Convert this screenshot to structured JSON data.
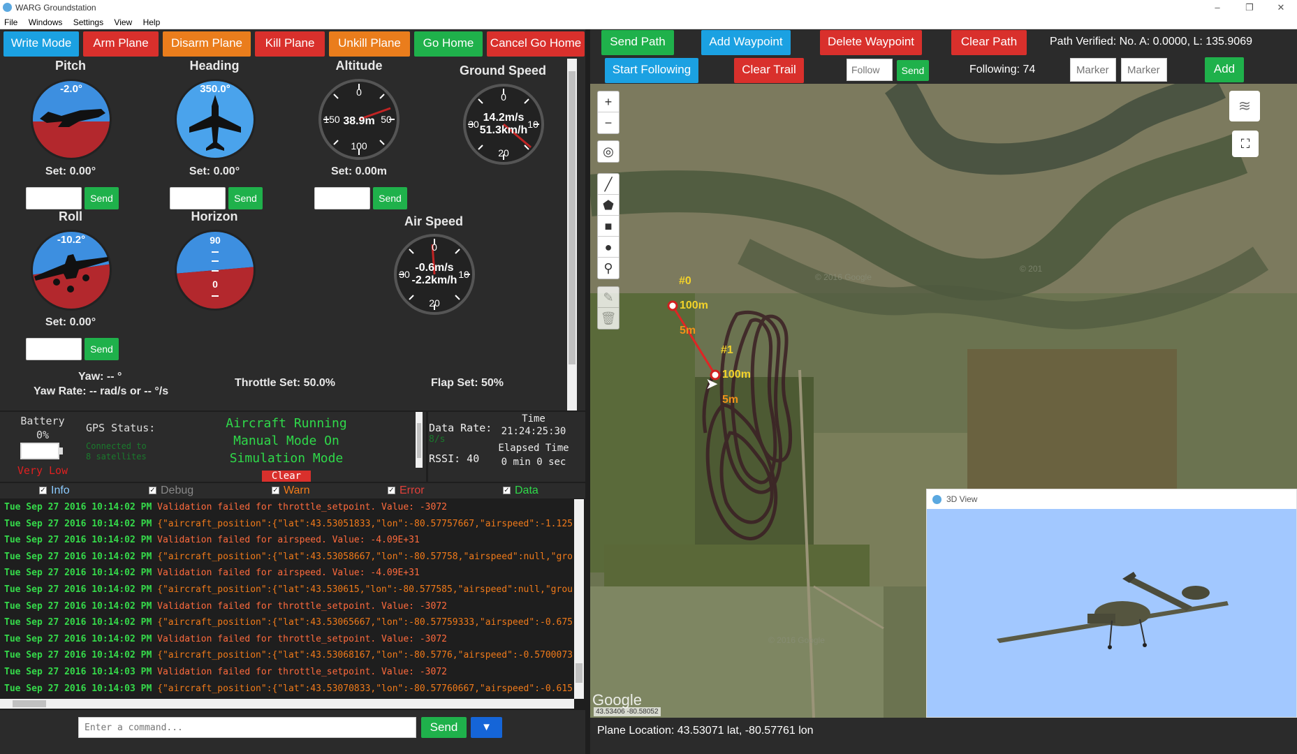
{
  "window": {
    "title": "WARG Groundstation",
    "minimize": "–",
    "restore": "❐",
    "close": "✕"
  },
  "menu": [
    "File",
    "Windows",
    "Settings",
    "View",
    "Help"
  ],
  "toolbar_left": [
    "Write Mode",
    "Arm Plane",
    "Disarm Plane",
    "Kill Plane",
    "Unkill Plane",
    "Go Home",
    "Cancel Go Home"
  ],
  "gauges": {
    "pitch": {
      "label": "Pitch",
      "value": "-2.0°",
      "set": "Set: 0.00°"
    },
    "heading": {
      "label": "Heading",
      "value": "350.0°",
      "set": "Set: 0.00°"
    },
    "altitude": {
      "label": "Altitude",
      "value": "38.9m",
      "set": "Set: 0.00m",
      "ticks": [
        "0",
        "50",
        "100",
        "150"
      ]
    },
    "ground_speed": {
      "label": "Ground Speed",
      "value_ms": "14.2m/s",
      "value_kmh": "51.3km/h",
      "ticks": [
        "0",
        "10",
        "20",
        "30"
      ]
    },
    "roll": {
      "label": "Roll",
      "value": "-10.2°",
      "set": "Set: 0.00°"
    },
    "horizon": {
      "label": "Horizon",
      "top": "90",
      "mid": "0"
    },
    "air_speed": {
      "label": "Air Speed",
      "value_ms": "-0.6m/s",
      "value_kmh": "-2.2km/h",
      "ticks": [
        "0",
        "10",
        "20",
        "30"
      ]
    },
    "send_label": "Send"
  },
  "controls_text": {
    "yaw": "Yaw: -- °",
    "yaw_rate": "Yaw Rate: -- rad/s or -- °/s",
    "throttle": "Throttle Set: 50.0%",
    "flap": "Flap Set: 50%"
  },
  "status": {
    "battery_label": "Battery",
    "battery_pct": "0%",
    "battery_state": "Very Low",
    "gps_label": "GPS Status:",
    "gps_detail_1": "Connected to",
    "gps_detail_2": "8 satellites",
    "mode_1": "Aircraft Running",
    "mode_2": "Manual Mode On",
    "mode_3": "Simulation Mode",
    "clear": "Clear",
    "data_rate_label": "Data Rate:",
    "data_rate_value": "8/s",
    "rssi": "RSSI: 40",
    "time_label": "Time",
    "time_value": "21:24:25:30",
    "elapsed_label": "Elapsed Time",
    "elapsed_value": "0 min 0 sec"
  },
  "filters": [
    "Info",
    "Debug",
    "Warn",
    "Error",
    "Data"
  ],
  "log": [
    {
      "ts": "Tue Sep 27 2016 10:14:02 PM",
      "msg": "Validation failed for throttle_setpoint. Value: -3072",
      "kind": "warn"
    },
    {
      "ts": "Tue Sep 27 2016 10:14:02 PM",
      "msg": "{\"aircraft_position\":{\"lat\":43.53051833,\"lon\":-80.57757667,\"airspeed\":-1.125",
      "kind": "data"
    },
    {
      "ts": "Tue Sep 27 2016 10:14:02 PM",
      "msg": "Validation failed for airspeed. Value: -4.09E+31",
      "kind": "warn"
    },
    {
      "ts": "Tue Sep 27 2016 10:14:02 PM",
      "msg": "{\"aircraft_position\":{\"lat\":43.53058667,\"lon\":-80.57758,\"airspeed\":null,\"gro",
      "kind": "data"
    },
    {
      "ts": "Tue Sep 27 2016 10:14:02 PM",
      "msg": "Validation failed for airspeed. Value: -4.09E+31",
      "kind": "warn"
    },
    {
      "ts": "Tue Sep 27 2016 10:14:02 PM",
      "msg": "{\"aircraft_position\":{\"lat\":43.530615,\"lon\":-80.577585,\"airspeed\":null,\"grou",
      "kind": "data"
    },
    {
      "ts": "Tue Sep 27 2016 10:14:02 PM",
      "msg": "Validation failed for throttle_setpoint. Value: -3072",
      "kind": "warn"
    },
    {
      "ts": "Tue Sep 27 2016 10:14:02 PM",
      "msg": "{\"aircraft_position\":{\"lat\":43.53065667,\"lon\":-80.57759333,\"airspeed\":-0.675",
      "kind": "data"
    },
    {
      "ts": "Tue Sep 27 2016 10:14:02 PM",
      "msg": "Validation failed for throttle_setpoint. Value: -3072",
      "kind": "warn"
    },
    {
      "ts": "Tue Sep 27 2016 10:14:02 PM",
      "msg": "{\"aircraft_position\":{\"lat\":43.53068167,\"lon\":-80.5776,\"airspeed\":-0.5700073",
      "kind": "data"
    },
    {
      "ts": "Tue Sep 27 2016 10:14:03 PM",
      "msg": "Validation failed for throttle_setpoint. Value: -3072",
      "kind": "warn"
    },
    {
      "ts": "Tue Sep 27 2016 10:14:03 PM",
      "msg": "{\"aircraft_position\":{\"lat\":43.53070833,\"lon\":-80.57760667,\"airspeed\":-0.615",
      "kind": "data"
    }
  ],
  "command": {
    "placeholder": "Enter a command...",
    "send": "Send",
    "dropdown": "▼"
  },
  "toolbar_right": {
    "send_path": "Send Path",
    "add_waypoint": "Add Waypoint",
    "delete_waypoint": "Delete Waypoint",
    "clear_path": "Clear Path",
    "path_verified": "Path Verified: No. A: 0.0000, L: 135.9069",
    "start_following": "Start Following",
    "clear_trail": "Clear Trail",
    "follow_placeholder": "Follow",
    "send": "Send",
    "following": "Following: 74",
    "marker1_placeholder": "Marker",
    "marker2_placeholder": "Marker",
    "add": "Add"
  },
  "map": {
    "zoom_in": "+",
    "zoom_out": "−",
    "wp0": "#0",
    "wp1": "#1",
    "wp0_alt": "100m",
    "wp1_alt": "100m",
    "wp0_radius": "5m",
    "wp1_radius": "5m",
    "watermark1": "© 2016 Google",
    "watermark2": "© 2016 Google",
    "watermark3": "© 201",
    "coords_box": "43.53406 -80.58052",
    "google": "Google"
  },
  "view3d": {
    "title": "3D View"
  },
  "footer": {
    "location": "Plane Location: 43.53071 lat, -80.57761 lon"
  },
  "colors": {
    "blue": "#1ba1e2",
    "red": "#d9302c",
    "orange": "#ea7d1c",
    "green": "#1fb14b",
    "log_ts": "#35d94a",
    "warn": "#ff6b3d",
    "data": "#f07a1a"
  }
}
